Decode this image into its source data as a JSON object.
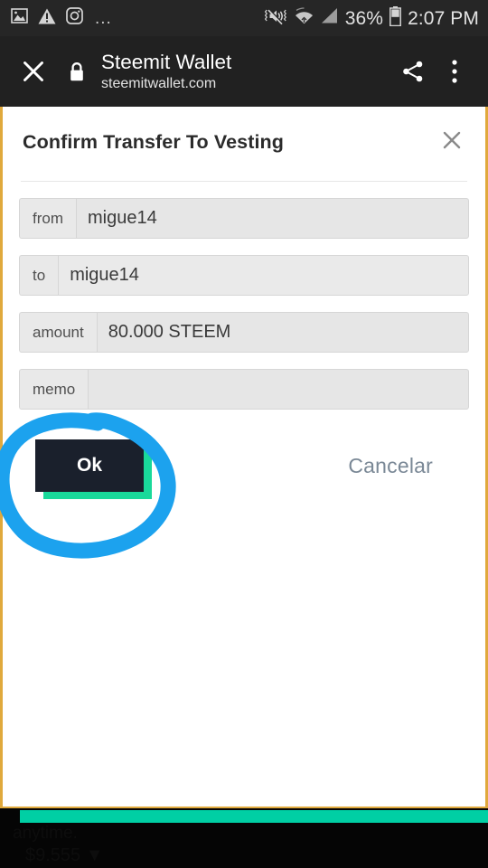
{
  "status_bar": {
    "left_icons": [
      "image-icon",
      "warning-icon",
      "instagram-icon"
    ],
    "overflow_dots": "...",
    "right_icons": [
      "vibrate-mute-icon",
      "wifi-icon",
      "cellular-signal-icon",
      "battery-icon"
    ],
    "battery_percent": "36%",
    "clock": "2:07 PM"
  },
  "toolbar": {
    "close_icon": "close-icon",
    "security_icon": "lock-icon",
    "title": "Steemit Wallet",
    "url": "steemitwallet.com",
    "share_icon": "share-icon",
    "overflow_icon": "more-vertical-icon"
  },
  "dialog": {
    "title": "Confirm Transfer To Vesting",
    "close_icon": "close-icon",
    "fields": [
      {
        "label": "from",
        "value": "migue14",
        "placeholder": "",
        "style": "default"
      },
      {
        "label": "to",
        "value": "migue14",
        "placeholder": "",
        "style": "lighter"
      },
      {
        "label": "amount",
        "value": "80.000 STEEM",
        "placeholder": "",
        "style": "default"
      },
      {
        "label": "memo",
        "value": "",
        "placeholder": "",
        "style": "empty"
      }
    ],
    "ok_label": "Ok",
    "cancel_label": "Cancelar"
  },
  "annotation": {
    "shape": "hand-drawn-circle",
    "color": "#1CA2EE",
    "target": "ok-button"
  },
  "background_page": {
    "line1": "anytime.",
    "line2": "$9.555 ▼"
  },
  "colors": {
    "page_border": "#e0a93c",
    "accent_bar": "#00cfa4",
    "button_bg": "#1a202c",
    "button_shadow": "#19d99a",
    "cancel_text": "#7a8896",
    "status_bar_bg": "#262626",
    "toolbar_bg": "#212121"
  }
}
